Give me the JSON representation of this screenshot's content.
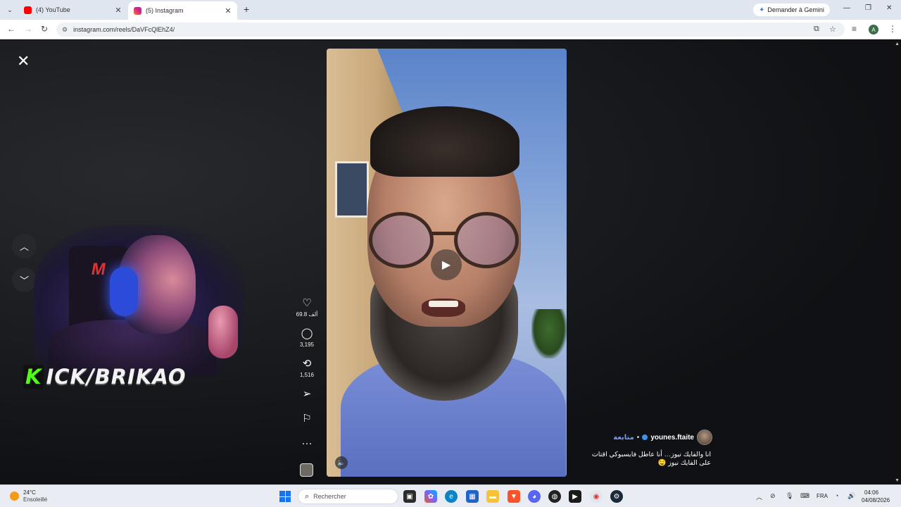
{
  "browser": {
    "tabs": [
      {
        "title": "(4) YouTube",
        "favicon": "youtube-icon",
        "active": false
      },
      {
        "title": "(5) Instagram",
        "favicon": "instagram-icon",
        "active": true
      }
    ],
    "gemini_button": "Demander à Gemini",
    "url": "instagram.com/reels/DaVFcQlEhZ4/"
  },
  "overlay": {
    "kick_letter": "K",
    "kick_rest": "ICK/BRIKAO",
    "kick_color": "#53fc18"
  },
  "reel": {
    "likes": "69.8 ألف",
    "comments": "3,195",
    "reposts": "1,516",
    "caption": {
      "username": "younes.ftaite",
      "separator": "•",
      "follow_label": "متابعة",
      "text": "انا والفايك نيوز… أنا عاطل فايسبوكي اقتات على الفايك نيوز 🤤"
    }
  },
  "taskbar": {
    "weather_temp": "24°C",
    "weather_desc": "Ensoleillé",
    "search_placeholder": "Rechercher",
    "language": "FRA",
    "time": "04:06",
    "date": "04/08/2026"
  }
}
